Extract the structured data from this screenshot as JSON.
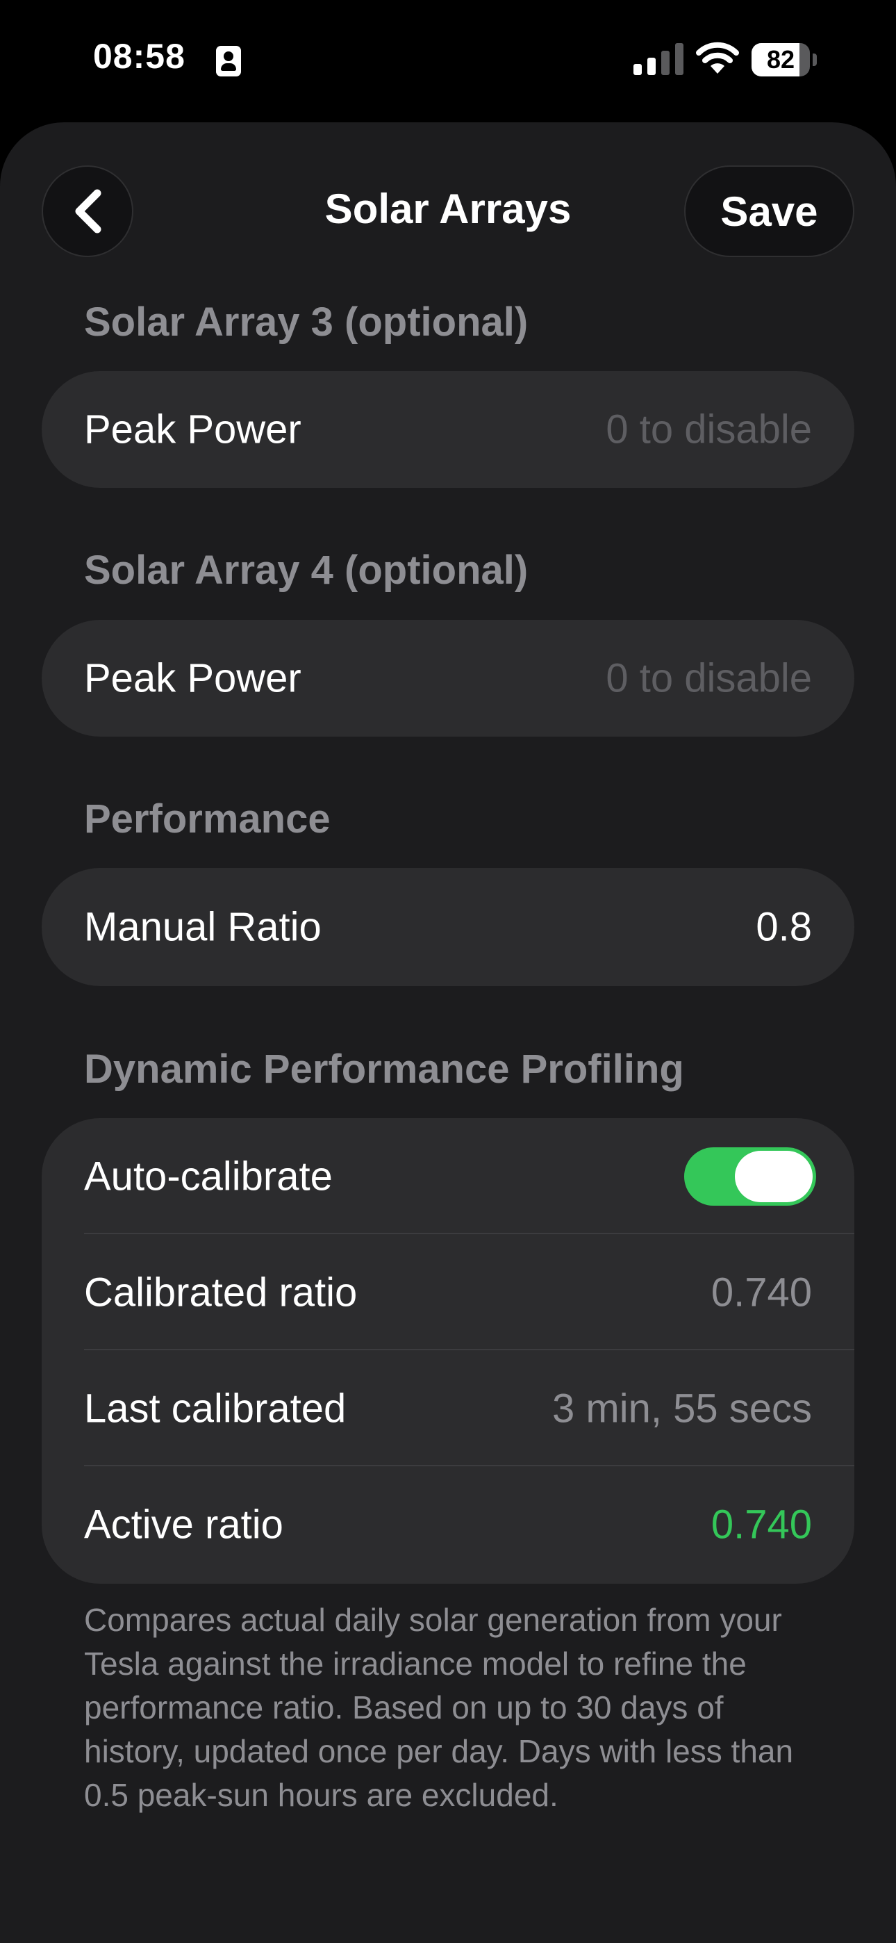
{
  "status_bar": {
    "time": "08:58",
    "battery_percent": 82,
    "battery_label": "82",
    "icons": [
      "contact-card-icon",
      "cellular-signal-icon",
      "wifi-icon",
      "battery-icon"
    ]
  },
  "nav": {
    "back_icon": "chevron-left-icon",
    "title": "Solar Arrays",
    "save_label": "Save"
  },
  "sections": {
    "array3": {
      "header": "Solar Array 3 (optional)",
      "peak_power_label": "Peak Power",
      "peak_power_placeholder": "0 to disable"
    },
    "array4": {
      "header": "Solar Array 4 (optional)",
      "peak_power_label": "Peak Power",
      "peak_power_placeholder": "0 to disable"
    },
    "performance": {
      "header": "Performance",
      "manual_ratio_label": "Manual Ratio",
      "manual_ratio_value": "0.8"
    },
    "dynamic": {
      "header": "Dynamic Performance Profiling",
      "auto_calibrate_label": "Auto-calibrate",
      "auto_calibrate_on": true,
      "calibrated_ratio_label": "Calibrated ratio",
      "calibrated_ratio_value": "0.740",
      "last_calibrated_label": "Last calibrated",
      "last_calibrated_value": "3 min, 55 secs",
      "active_ratio_label": "Active ratio",
      "active_ratio_value": "0.740",
      "footer": "Compares actual daily solar generation from your Tesla against the irradiance model to refine the performance ratio. Based on up to 30 days of history, updated once per day. Days with less than 0.5 peak-sun hours are excluded."
    }
  },
  "colors": {
    "background": "#1c1c1e",
    "card": "#2c2c2e",
    "secondary_text": "#8e8e93",
    "accent_green": "#34c759"
  }
}
